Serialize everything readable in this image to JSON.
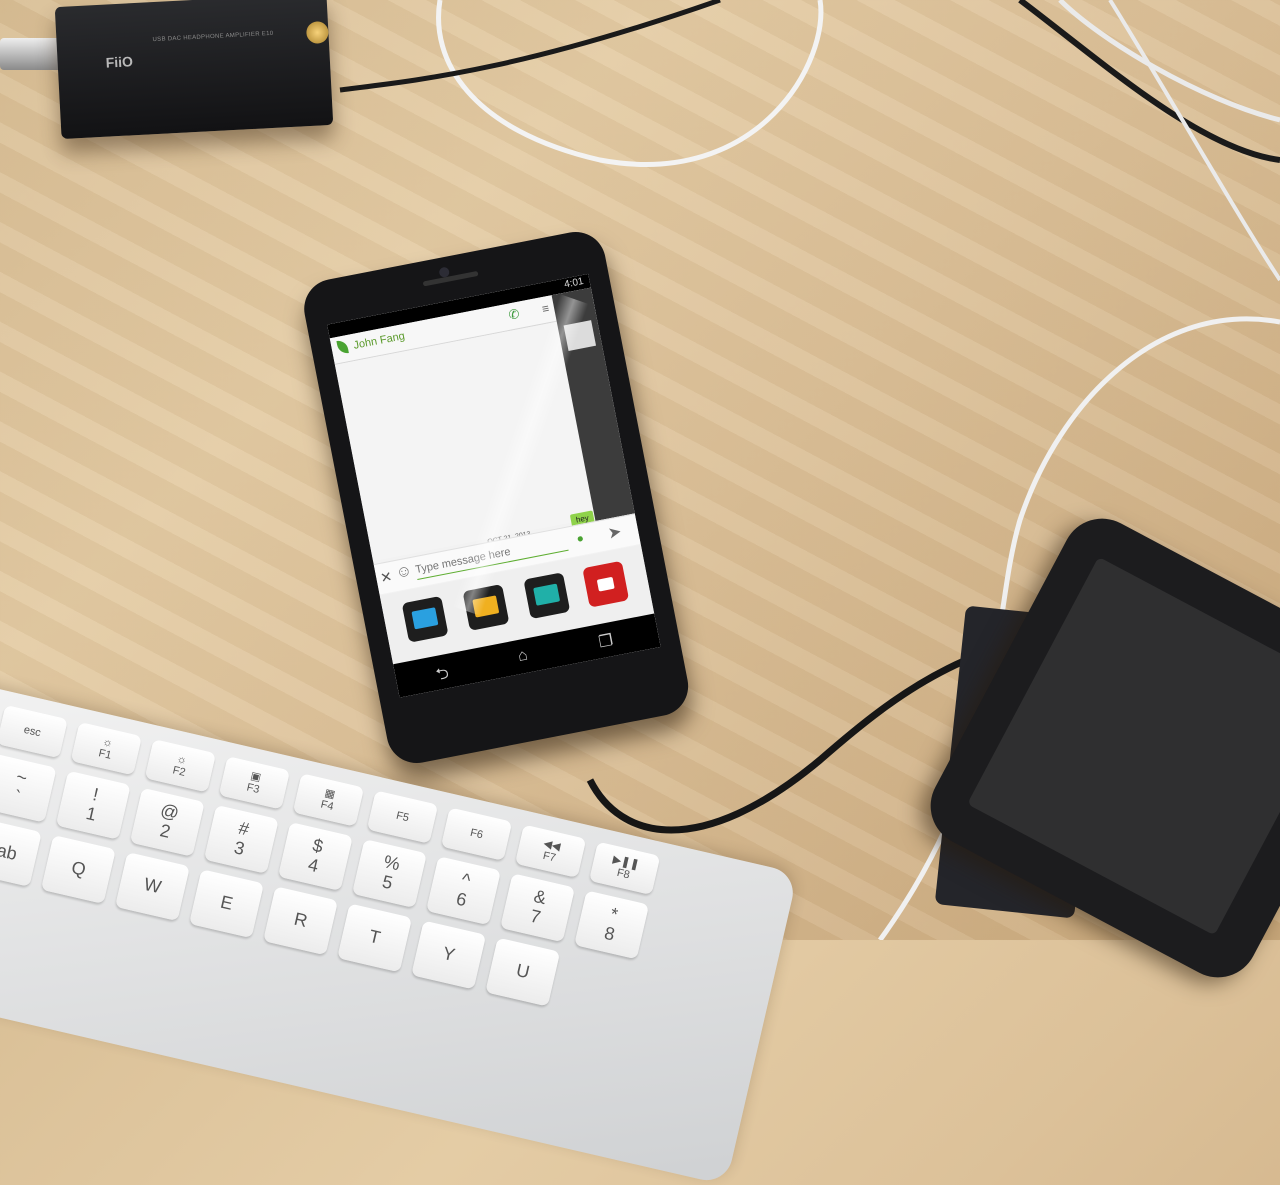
{
  "dac": {
    "brand": "FiiO",
    "subtitle": "USB DAC HEADPHONE AMPLIFIER E10"
  },
  "phone": {
    "status_time": "4:01",
    "contact_name": "John Fang",
    "date_separator": "OCT 21, 2013",
    "last_message": "hey",
    "message_placeholder": "Type message here",
    "close_glyph": "✕",
    "smile_glyph": "☺",
    "send_glyph": "➤",
    "phone_glyph": "✆",
    "menu_glyph": "≡",
    "mic_glyph": "🎤",
    "nav_back": "⮌",
    "nav_home": "⌂",
    "nav_recent": "❐",
    "attachments": [
      "image-attach-icon",
      "gallery-attach-icon",
      "location-attach-icon",
      "video-attach-icon"
    ]
  },
  "keyboard": {
    "row_fn": [
      "esc",
      "☼\nF1",
      "☼\nF2",
      "▣\nF3",
      "▦\nF4",
      "F5",
      "F6",
      "◀◀\nF7",
      "▶❚❚\nF8"
    ],
    "row_num": [
      "~\n`",
      "!\n1",
      "@\n2",
      "#\n3",
      "$\n4",
      "%\n5",
      "^\n6",
      "&\n7",
      "*\n8"
    ],
    "row_q": [
      "tab",
      "Q",
      "W",
      "E",
      "R",
      "T",
      "Y",
      "U"
    ]
  },
  "colors": {
    "accent_green": "#4aa332",
    "bubble_green": "#8fd24b",
    "desk": "#dcc199"
  }
}
